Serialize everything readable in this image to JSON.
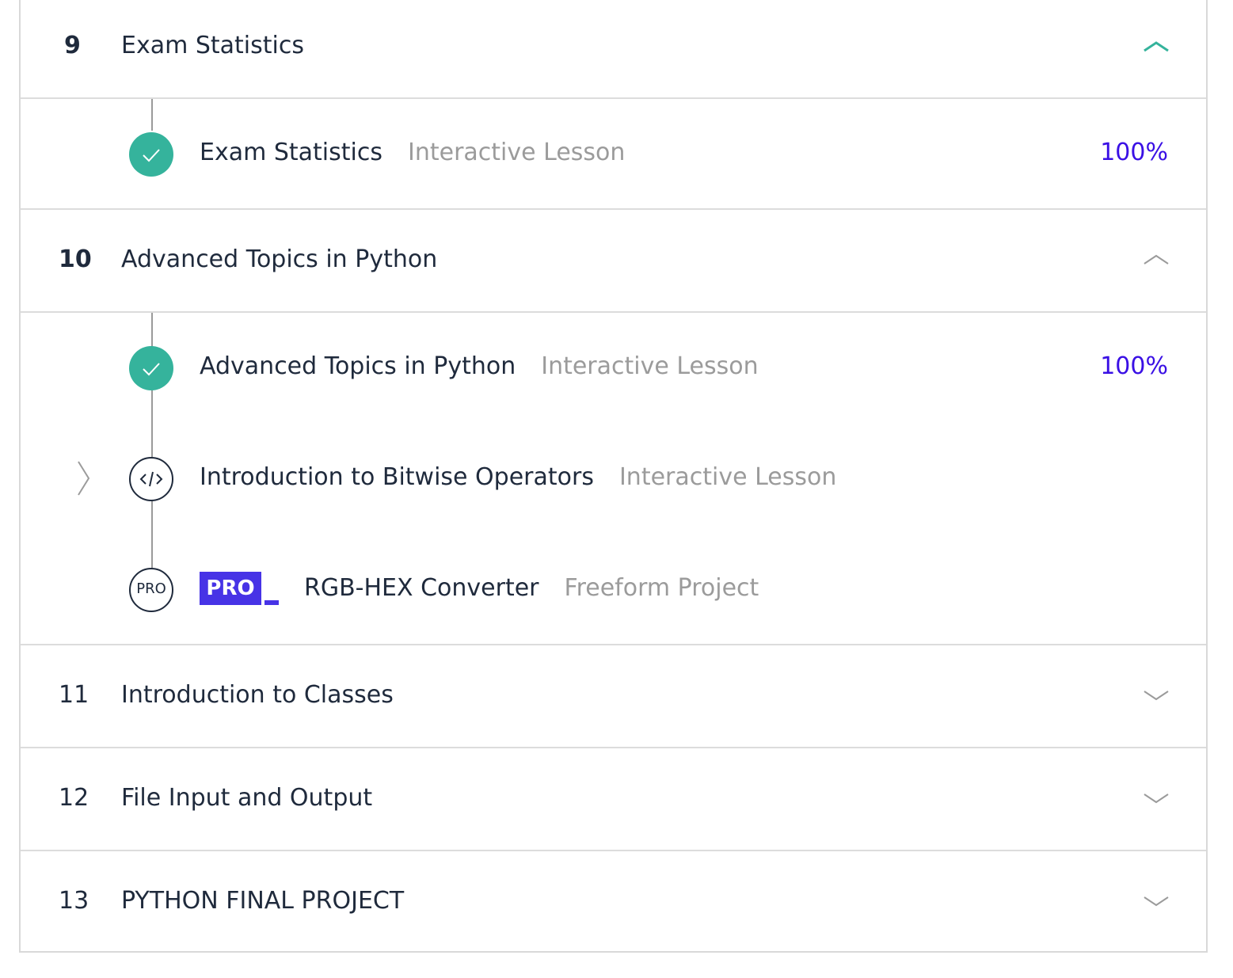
{
  "modules": [
    {
      "number": "9",
      "title": "Exam Statistics",
      "expanded": true,
      "chevron_color": "#35b39c"
    },
    {
      "number": "10",
      "title": "Advanced Topics in Python",
      "expanded": true,
      "chevron_color": "#9b9b9b"
    },
    {
      "number": "11",
      "title": "Introduction to Classes",
      "expanded": false,
      "chevron_color": "#9b9b9b"
    },
    {
      "number": "12",
      "title": "File Input and Output",
      "expanded": false,
      "chevron_color": "#9b9b9b"
    },
    {
      "number": "13",
      "title": "PYTHON FINAL PROJECT",
      "expanded": false,
      "chevron_color": "#9b9b9b"
    }
  ],
  "module9_lessons": [
    {
      "title": "Exam Statistics",
      "type": "Interactive Lesson",
      "progress": "100%",
      "status": "completed",
      "icon": "check-icon"
    }
  ],
  "module10_lessons": [
    {
      "title": "Advanced Topics in Python",
      "type": "Interactive Lesson",
      "progress": "100%",
      "status": "completed",
      "icon": "check-icon"
    },
    {
      "title": "Introduction to Bitwise Operators",
      "type": "Interactive Lesson",
      "progress": "",
      "status": "current",
      "icon": "code-icon"
    },
    {
      "title": "RGB-HEX Converter",
      "type": "Freeform Project",
      "progress": "",
      "status": "locked-pro",
      "icon": "pro-icon",
      "badge": "PRO",
      "circle_label": "PRO"
    }
  ],
  "colors": {
    "accent_green": "#35b39c",
    "progress_purple": "#3a10e5",
    "pro_badge": "#4733e6"
  }
}
